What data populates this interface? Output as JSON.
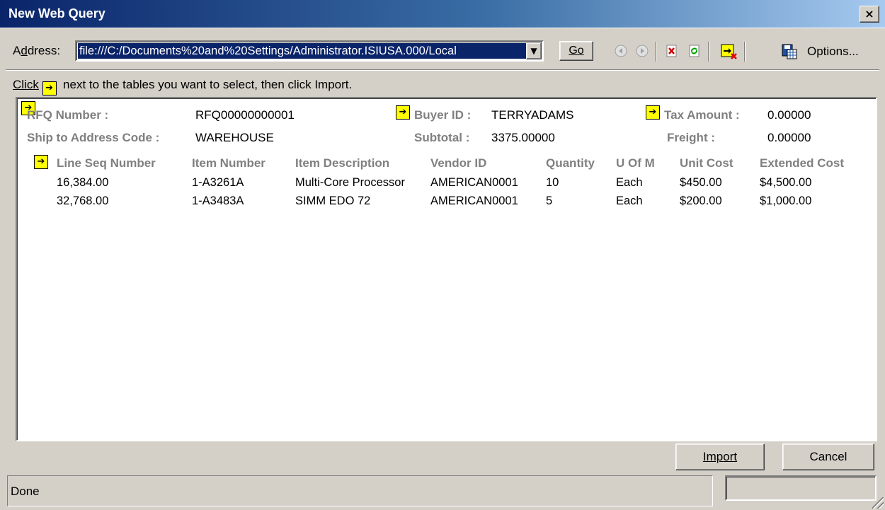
{
  "window": {
    "title": "New Web Query",
    "close_glyph": "×"
  },
  "toolbar": {
    "address_label_pre": "A",
    "address_label_ul": "d",
    "address_label_post": "dress:",
    "address_value": "file:///C:/Documents%20and%20Settings/Administrator.ISIUSA.000/Local",
    "go_label": "Go",
    "options_label": "Options...",
    "icons": [
      "back-icon",
      "forward-icon",
      "stop-icon",
      "refresh-icon",
      "hide-icons-icon",
      "save-query-icon"
    ]
  },
  "instruction": {
    "click": "Click",
    "rest": "next to the tables you want to select, then click Import."
  },
  "header_fields": {
    "rfq_number_label": "RFQ Number :",
    "rfq_number_value": "RFQ00000000001",
    "buyer_id_label": "Buyer ID :",
    "buyer_id_value": "TERRYADAMS",
    "tax_amount_label": "Tax Amount :",
    "tax_amount_value": "0.00000",
    "ship_to_label": "Ship to Address Code :",
    "ship_to_value": "WAREHOUSE",
    "subtotal_label": "Subtotal :",
    "subtotal_value": "3375.00000",
    "freight_label": "Freight :",
    "freight_value": "0.00000"
  },
  "lines_table": {
    "columns": [
      "Line Seq Number",
      "Item Number",
      "Item Description",
      "Vendor ID",
      "Quantity",
      "U Of M",
      "Unit Cost",
      "Extended Cost"
    ],
    "rows": [
      [
        "16,384.00",
        "1-A3261A",
        "Multi-Core Processor",
        "AMERICAN0001",
        "10",
        "Each",
        "$450.00",
        "$4,500.00"
      ],
      [
        "32,768.00",
        "1-A3483A",
        "SIMM EDO 72",
        "AMERICAN0001",
        "5",
        "Each",
        "$200.00",
        "$1,000.00"
      ]
    ]
  },
  "buttons": {
    "import": "Import",
    "cancel": "Cancel"
  },
  "status": {
    "text": "Done"
  },
  "colors": {
    "selection_arrow": "#ffff00",
    "title_bar": "#0a246a",
    "label_gray": "#808080"
  }
}
